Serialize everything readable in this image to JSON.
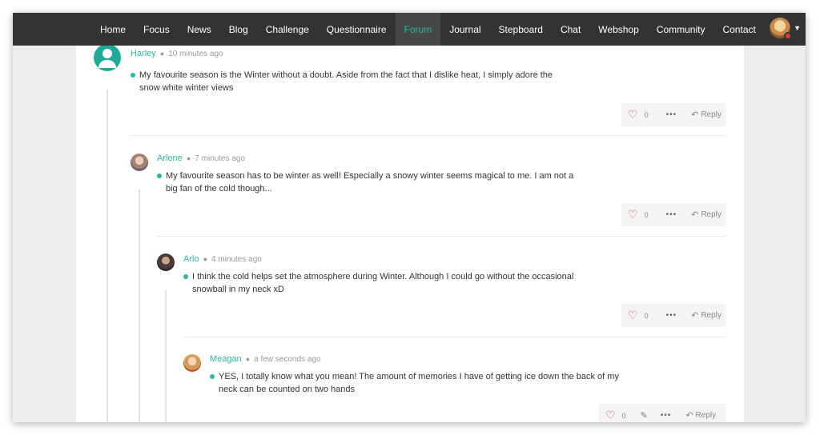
{
  "nav": {
    "items": [
      {
        "label": "Home",
        "active": false
      },
      {
        "label": "Focus",
        "active": false
      },
      {
        "label": "News",
        "active": false
      },
      {
        "label": "Blog",
        "active": false
      },
      {
        "label": "Challenge",
        "active": false
      },
      {
        "label": "Questionnaire",
        "active": false
      },
      {
        "label": "Forum",
        "active": true
      },
      {
        "label": "Journal",
        "active": false
      },
      {
        "label": "Stepboard",
        "active": false
      },
      {
        "label": "Chat",
        "active": false
      },
      {
        "label": "Webshop",
        "active": false
      },
      {
        "label": "Community",
        "active": false
      },
      {
        "label": "Contact",
        "active": false
      }
    ],
    "avatar_icon": "user-avatar",
    "chevron_icon": "chevron-down-icon",
    "accent": "#2cb5a3",
    "bar_color": "#333333",
    "status_color": "#e03a3a"
  },
  "comments": [
    {
      "author": "Harley",
      "time": "10 minutes ago",
      "text_line1": "My favourite season is the Winter without a doubt. Aside from the fact that I dislike heat, I simply adore the",
      "text_line2": "snow white winter views",
      "likes": "0",
      "reply": "Reply"
    },
    {
      "author": "Arlene",
      "time": "7 minutes ago",
      "text_line1": "My favourite season has to be winter as well! Especially a snowy winter seems magical to me. I am not a",
      "text_line2": "big fan of the cold though...",
      "likes": "0",
      "reply": "Reply"
    },
    {
      "author": "Arlo",
      "time": "4 minutes ago",
      "text_line1": "I think the cold helps set the atmosphere during Winter. Although I could go without the occasional",
      "text_line2": "snowball in my neck xD",
      "likes": "0",
      "reply": "Reply"
    },
    {
      "author": "Meagan",
      "time": "a few seconds ago",
      "text_line1": "YES, I totally know what you mean! The amount of memories I have of getting ice down the back of my",
      "text_line2": "neck can be counted on two hands",
      "likes": "0",
      "reply": "Reply"
    }
  ],
  "icons": {
    "like": "heart-icon",
    "more": "more-icon",
    "reply": "reply-icon",
    "edit": "pencil-icon"
  },
  "colors": {
    "like": "#e0464a",
    "bullet": "#2cb5a3"
  }
}
